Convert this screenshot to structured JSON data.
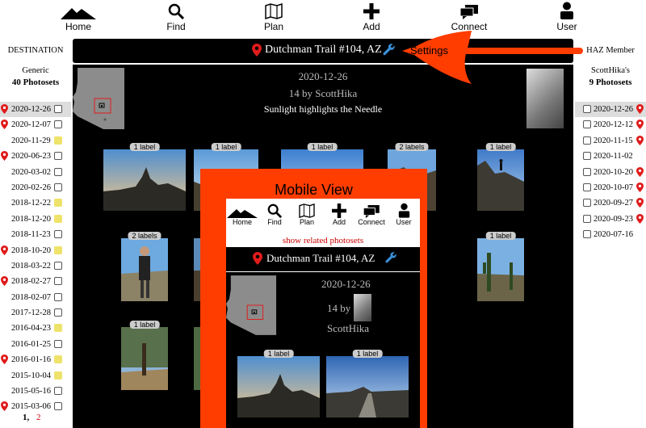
{
  "nav": {
    "items": [
      {
        "label": "Home",
        "icon": "mountain-icon"
      },
      {
        "label": "Find",
        "icon": "search-icon"
      },
      {
        "label": "Plan",
        "icon": "map-icon"
      },
      {
        "label": "Add",
        "icon": "plus-icon"
      },
      {
        "label": "Connect",
        "icon": "chat-icon"
      },
      {
        "label": "User",
        "icon": "user-icon"
      }
    ]
  },
  "left": {
    "heading": "DESTINATION",
    "subheading": "Generic",
    "count": "40 Photosets",
    "rows": [
      {
        "date": "2020-12-26",
        "pin": true,
        "box": "white",
        "selected": true
      },
      {
        "date": "2020-12-07",
        "pin": true,
        "box": "white"
      },
      {
        "date": "2020-11-29",
        "pin": false,
        "box": "yellow"
      },
      {
        "date": "2020-06-23",
        "pin": true,
        "box": "white"
      },
      {
        "date": "2020-03-02",
        "pin": false,
        "box": "white"
      },
      {
        "date": "2020-02-26",
        "pin": false,
        "box": "white"
      },
      {
        "date": "2018-12-22",
        "pin": false,
        "box": "yellow"
      },
      {
        "date": "2018-12-20",
        "pin": false,
        "box": "yellow"
      },
      {
        "date": "2018-11-23",
        "pin": false,
        "box": "white"
      },
      {
        "date": "2018-10-20",
        "pin": true,
        "box": "yellow"
      },
      {
        "date": "2018-03-22",
        "pin": false,
        "box": "white"
      },
      {
        "date": "2018-02-27",
        "pin": true,
        "box": "white"
      },
      {
        "date": "2018-02-07",
        "pin": false,
        "box": "white"
      },
      {
        "date": "2017-12-28",
        "pin": false,
        "box": "white"
      },
      {
        "date": "2016-04-23",
        "pin": false,
        "box": "yellow"
      },
      {
        "date": "2016-01-25",
        "pin": false,
        "box": "white"
      },
      {
        "date": "2016-01-16",
        "pin": true,
        "box": "yellow"
      },
      {
        "date": "2015-10-04",
        "pin": false,
        "box": "yellow"
      },
      {
        "date": "2015-05-16",
        "pin": false,
        "box": "white"
      },
      {
        "date": "2015-03-06",
        "pin": true,
        "box": "white"
      }
    ],
    "pager": {
      "current": "1,",
      "next": "2"
    }
  },
  "right": {
    "heading": "HAZ Member",
    "subheading": "ScottHika's",
    "count": "9 Photosets",
    "rows": [
      {
        "date": "2020-12-26",
        "pin": true,
        "selected": true
      },
      {
        "date": "2020-12-12",
        "pin": true
      },
      {
        "date": "2020-11-15",
        "pin": true
      },
      {
        "date": "2020-11-02",
        "pin": false
      },
      {
        "date": "2020-10-20",
        "pin": true
      },
      {
        "date": "2020-10-07",
        "pin": true
      },
      {
        "date": "2020-09-27",
        "pin": true
      },
      {
        "date": "2020-09-23",
        "pin": true
      },
      {
        "date": "2020-07-16",
        "pin": false
      }
    ]
  },
  "title": {
    "trail": "Dutchman Trail #104, AZ",
    "settings_label": "Settings"
  },
  "photoset": {
    "date": "2020-12-26",
    "byline": "14 by ScottHika",
    "caption": "Sunlight highlights the Needle"
  },
  "thumbs": [
    {
      "badge": "1 label",
      "scene": "needle"
    },
    {
      "badge": "1 label",
      "scene": "valley"
    },
    {
      "badge": "1 label",
      "scene": "sky"
    },
    {
      "badge": "2 labels",
      "scene": "ridge"
    },
    {
      "badge": "1 label",
      "scene": "hiker-peak"
    },
    {
      "badge": "2 labels",
      "scene": "hiker"
    },
    {
      "badge": "1 label",
      "scene": "saguaro"
    },
    {
      "badge": "1 label",
      "scene": "trees"
    }
  ],
  "mobile": {
    "title": "Mobile View",
    "related": "show related photosets",
    "trail": "Dutchman Trail #104, AZ",
    "date": "2020-12-26",
    "by_prefix": "14 by",
    "user": "ScottHika",
    "badges": [
      "1 label",
      "1 label"
    ]
  },
  "colors": {
    "accent_red": "#e01b1b",
    "overlay_orange": "#ff3d00",
    "wrench_blue": "#3a8fd8",
    "marker_yellow": "#eee36a"
  }
}
